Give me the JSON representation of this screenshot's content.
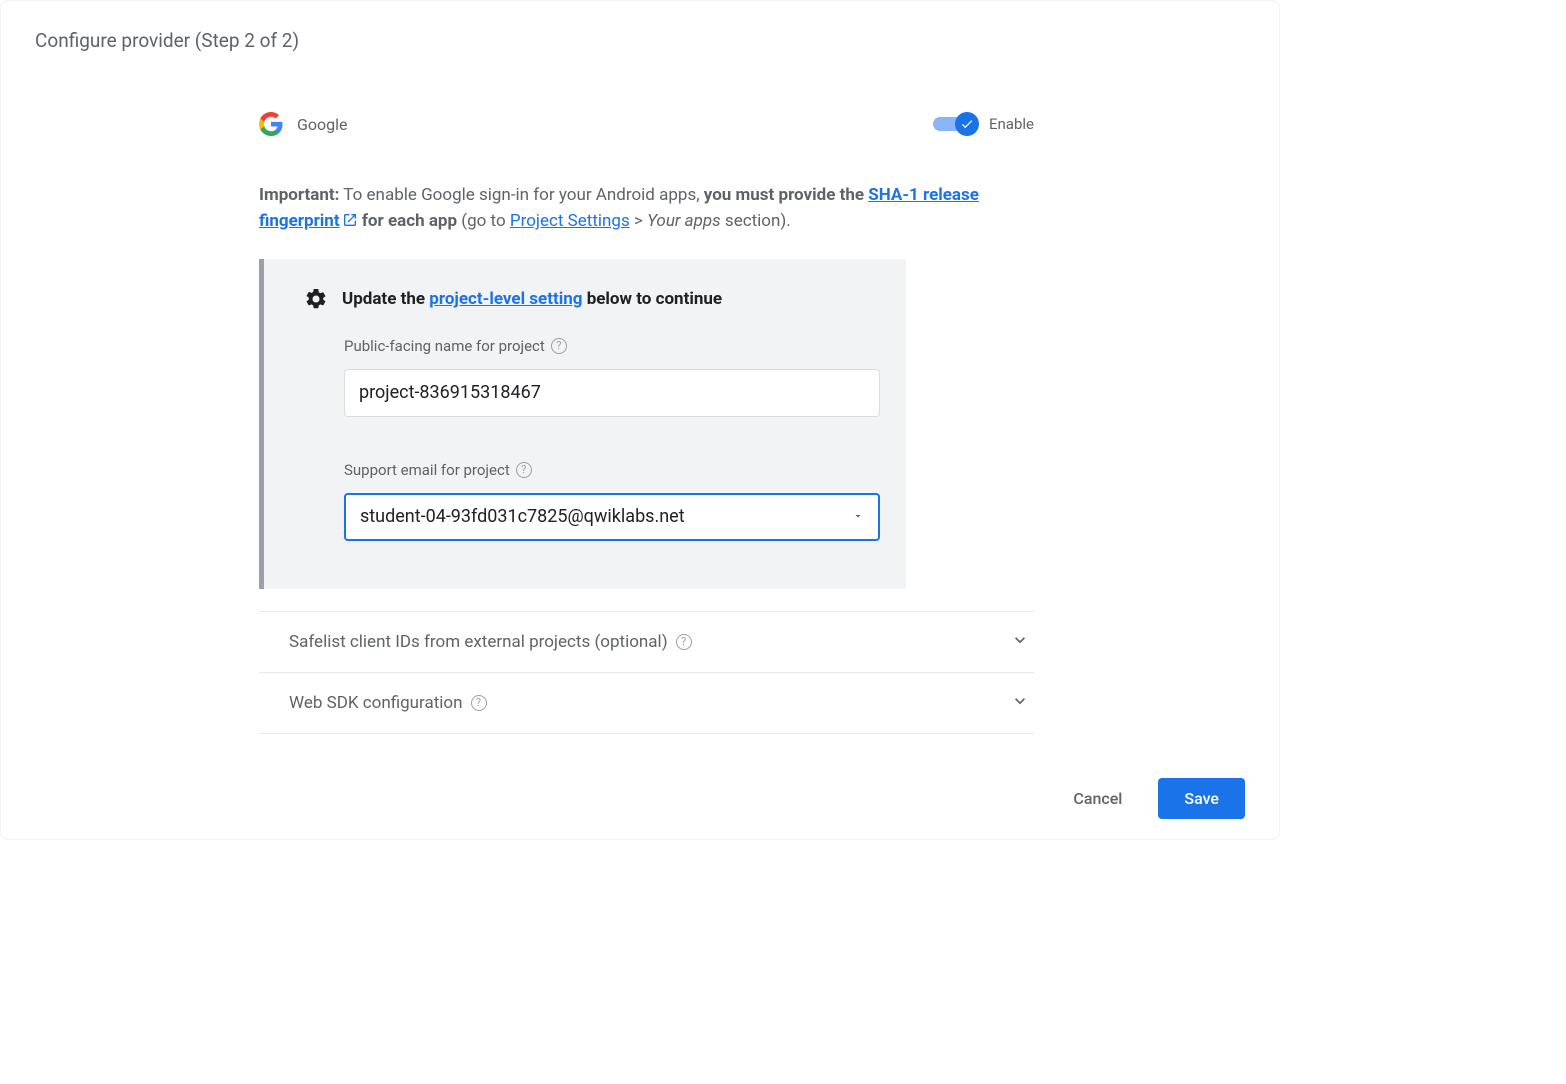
{
  "header": {
    "title": "Configure provider (Step 2 of 2)"
  },
  "provider": {
    "name": "Google",
    "enable_label": "Enable"
  },
  "important": {
    "prefix": "Important:",
    "text1": " To enable Google sign-in for your Android apps, ",
    "bold1": "you must provide the ",
    "link1": "SHA-1 release fingerprint",
    "bold2": " for each app",
    "text2": " (go to ",
    "link2": "Project Settings",
    "text3": " > ",
    "italic1": "Your apps",
    "text4": " section)."
  },
  "settings": {
    "head_pre": "Update the ",
    "head_link": "project-level setting",
    "head_post": " below to continue",
    "name_label": "Public-facing name for project",
    "name_value": "project-836915318467",
    "email_label": "Support email for project",
    "email_value": "student-04-93fd031c7825@qwiklabs.net"
  },
  "expanders": {
    "safelist": "Safelist client IDs from external projects (optional)",
    "websdk": "Web SDK configuration"
  },
  "buttons": {
    "cancel": "Cancel",
    "save": "Save"
  }
}
